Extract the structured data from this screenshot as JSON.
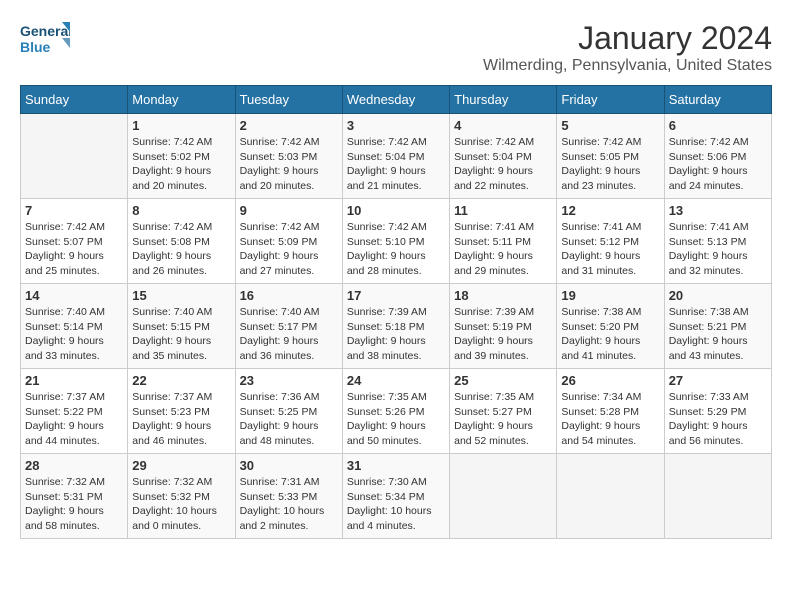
{
  "header": {
    "logo_line1": "General",
    "logo_line2": "Blue",
    "month": "January 2024",
    "location": "Wilmerding, Pennsylvania, United States"
  },
  "weekdays": [
    "Sunday",
    "Monday",
    "Tuesday",
    "Wednesday",
    "Thursday",
    "Friday",
    "Saturday"
  ],
  "weeks": [
    [
      {
        "day": "",
        "sunrise": "",
        "sunset": "",
        "daylight": ""
      },
      {
        "day": "1",
        "sunrise": "Sunrise: 7:42 AM",
        "sunset": "Sunset: 5:02 PM",
        "daylight": "Daylight: 9 hours and 20 minutes."
      },
      {
        "day": "2",
        "sunrise": "Sunrise: 7:42 AM",
        "sunset": "Sunset: 5:03 PM",
        "daylight": "Daylight: 9 hours and 20 minutes."
      },
      {
        "day": "3",
        "sunrise": "Sunrise: 7:42 AM",
        "sunset": "Sunset: 5:04 PM",
        "daylight": "Daylight: 9 hours and 21 minutes."
      },
      {
        "day": "4",
        "sunrise": "Sunrise: 7:42 AM",
        "sunset": "Sunset: 5:04 PM",
        "daylight": "Daylight: 9 hours and 22 minutes."
      },
      {
        "day": "5",
        "sunrise": "Sunrise: 7:42 AM",
        "sunset": "Sunset: 5:05 PM",
        "daylight": "Daylight: 9 hours and 23 minutes."
      },
      {
        "day": "6",
        "sunrise": "Sunrise: 7:42 AM",
        "sunset": "Sunset: 5:06 PM",
        "daylight": "Daylight: 9 hours and 24 minutes."
      }
    ],
    [
      {
        "day": "7",
        "sunrise": "Sunrise: 7:42 AM",
        "sunset": "Sunset: 5:07 PM",
        "daylight": "Daylight: 9 hours and 25 minutes."
      },
      {
        "day": "8",
        "sunrise": "Sunrise: 7:42 AM",
        "sunset": "Sunset: 5:08 PM",
        "daylight": "Daylight: 9 hours and 26 minutes."
      },
      {
        "day": "9",
        "sunrise": "Sunrise: 7:42 AM",
        "sunset": "Sunset: 5:09 PM",
        "daylight": "Daylight: 9 hours and 27 minutes."
      },
      {
        "day": "10",
        "sunrise": "Sunrise: 7:42 AM",
        "sunset": "Sunset: 5:10 PM",
        "daylight": "Daylight: 9 hours and 28 minutes."
      },
      {
        "day": "11",
        "sunrise": "Sunrise: 7:41 AM",
        "sunset": "Sunset: 5:11 PM",
        "daylight": "Daylight: 9 hours and 29 minutes."
      },
      {
        "day": "12",
        "sunrise": "Sunrise: 7:41 AM",
        "sunset": "Sunset: 5:12 PM",
        "daylight": "Daylight: 9 hours and 31 minutes."
      },
      {
        "day": "13",
        "sunrise": "Sunrise: 7:41 AM",
        "sunset": "Sunset: 5:13 PM",
        "daylight": "Daylight: 9 hours and 32 minutes."
      }
    ],
    [
      {
        "day": "14",
        "sunrise": "Sunrise: 7:40 AM",
        "sunset": "Sunset: 5:14 PM",
        "daylight": "Daylight: 9 hours and 33 minutes."
      },
      {
        "day": "15",
        "sunrise": "Sunrise: 7:40 AM",
        "sunset": "Sunset: 5:15 PM",
        "daylight": "Daylight: 9 hours and 35 minutes."
      },
      {
        "day": "16",
        "sunrise": "Sunrise: 7:40 AM",
        "sunset": "Sunset: 5:17 PM",
        "daylight": "Daylight: 9 hours and 36 minutes."
      },
      {
        "day": "17",
        "sunrise": "Sunrise: 7:39 AM",
        "sunset": "Sunset: 5:18 PM",
        "daylight": "Daylight: 9 hours and 38 minutes."
      },
      {
        "day": "18",
        "sunrise": "Sunrise: 7:39 AM",
        "sunset": "Sunset: 5:19 PM",
        "daylight": "Daylight: 9 hours and 39 minutes."
      },
      {
        "day": "19",
        "sunrise": "Sunrise: 7:38 AM",
        "sunset": "Sunset: 5:20 PM",
        "daylight": "Daylight: 9 hours and 41 minutes."
      },
      {
        "day": "20",
        "sunrise": "Sunrise: 7:38 AM",
        "sunset": "Sunset: 5:21 PM",
        "daylight": "Daylight: 9 hours and 43 minutes."
      }
    ],
    [
      {
        "day": "21",
        "sunrise": "Sunrise: 7:37 AM",
        "sunset": "Sunset: 5:22 PM",
        "daylight": "Daylight: 9 hours and 44 minutes."
      },
      {
        "day": "22",
        "sunrise": "Sunrise: 7:37 AM",
        "sunset": "Sunset: 5:23 PM",
        "daylight": "Daylight: 9 hours and 46 minutes."
      },
      {
        "day": "23",
        "sunrise": "Sunrise: 7:36 AM",
        "sunset": "Sunset: 5:25 PM",
        "daylight": "Daylight: 9 hours and 48 minutes."
      },
      {
        "day": "24",
        "sunrise": "Sunrise: 7:35 AM",
        "sunset": "Sunset: 5:26 PM",
        "daylight": "Daylight: 9 hours and 50 minutes."
      },
      {
        "day": "25",
        "sunrise": "Sunrise: 7:35 AM",
        "sunset": "Sunset: 5:27 PM",
        "daylight": "Daylight: 9 hours and 52 minutes."
      },
      {
        "day": "26",
        "sunrise": "Sunrise: 7:34 AM",
        "sunset": "Sunset: 5:28 PM",
        "daylight": "Daylight: 9 hours and 54 minutes."
      },
      {
        "day": "27",
        "sunrise": "Sunrise: 7:33 AM",
        "sunset": "Sunset: 5:29 PM",
        "daylight": "Daylight: 9 hours and 56 minutes."
      }
    ],
    [
      {
        "day": "28",
        "sunrise": "Sunrise: 7:32 AM",
        "sunset": "Sunset: 5:31 PM",
        "daylight": "Daylight: 9 hours and 58 minutes."
      },
      {
        "day": "29",
        "sunrise": "Sunrise: 7:32 AM",
        "sunset": "Sunset: 5:32 PM",
        "daylight": "Daylight: 10 hours and 0 minutes."
      },
      {
        "day": "30",
        "sunrise": "Sunrise: 7:31 AM",
        "sunset": "Sunset: 5:33 PM",
        "daylight": "Daylight: 10 hours and 2 minutes."
      },
      {
        "day": "31",
        "sunrise": "Sunrise: 7:30 AM",
        "sunset": "Sunset: 5:34 PM",
        "daylight": "Daylight: 10 hours and 4 minutes."
      },
      {
        "day": "",
        "sunrise": "",
        "sunset": "",
        "daylight": ""
      },
      {
        "day": "",
        "sunrise": "",
        "sunset": "",
        "daylight": ""
      },
      {
        "day": "",
        "sunrise": "",
        "sunset": "",
        "daylight": ""
      }
    ]
  ]
}
